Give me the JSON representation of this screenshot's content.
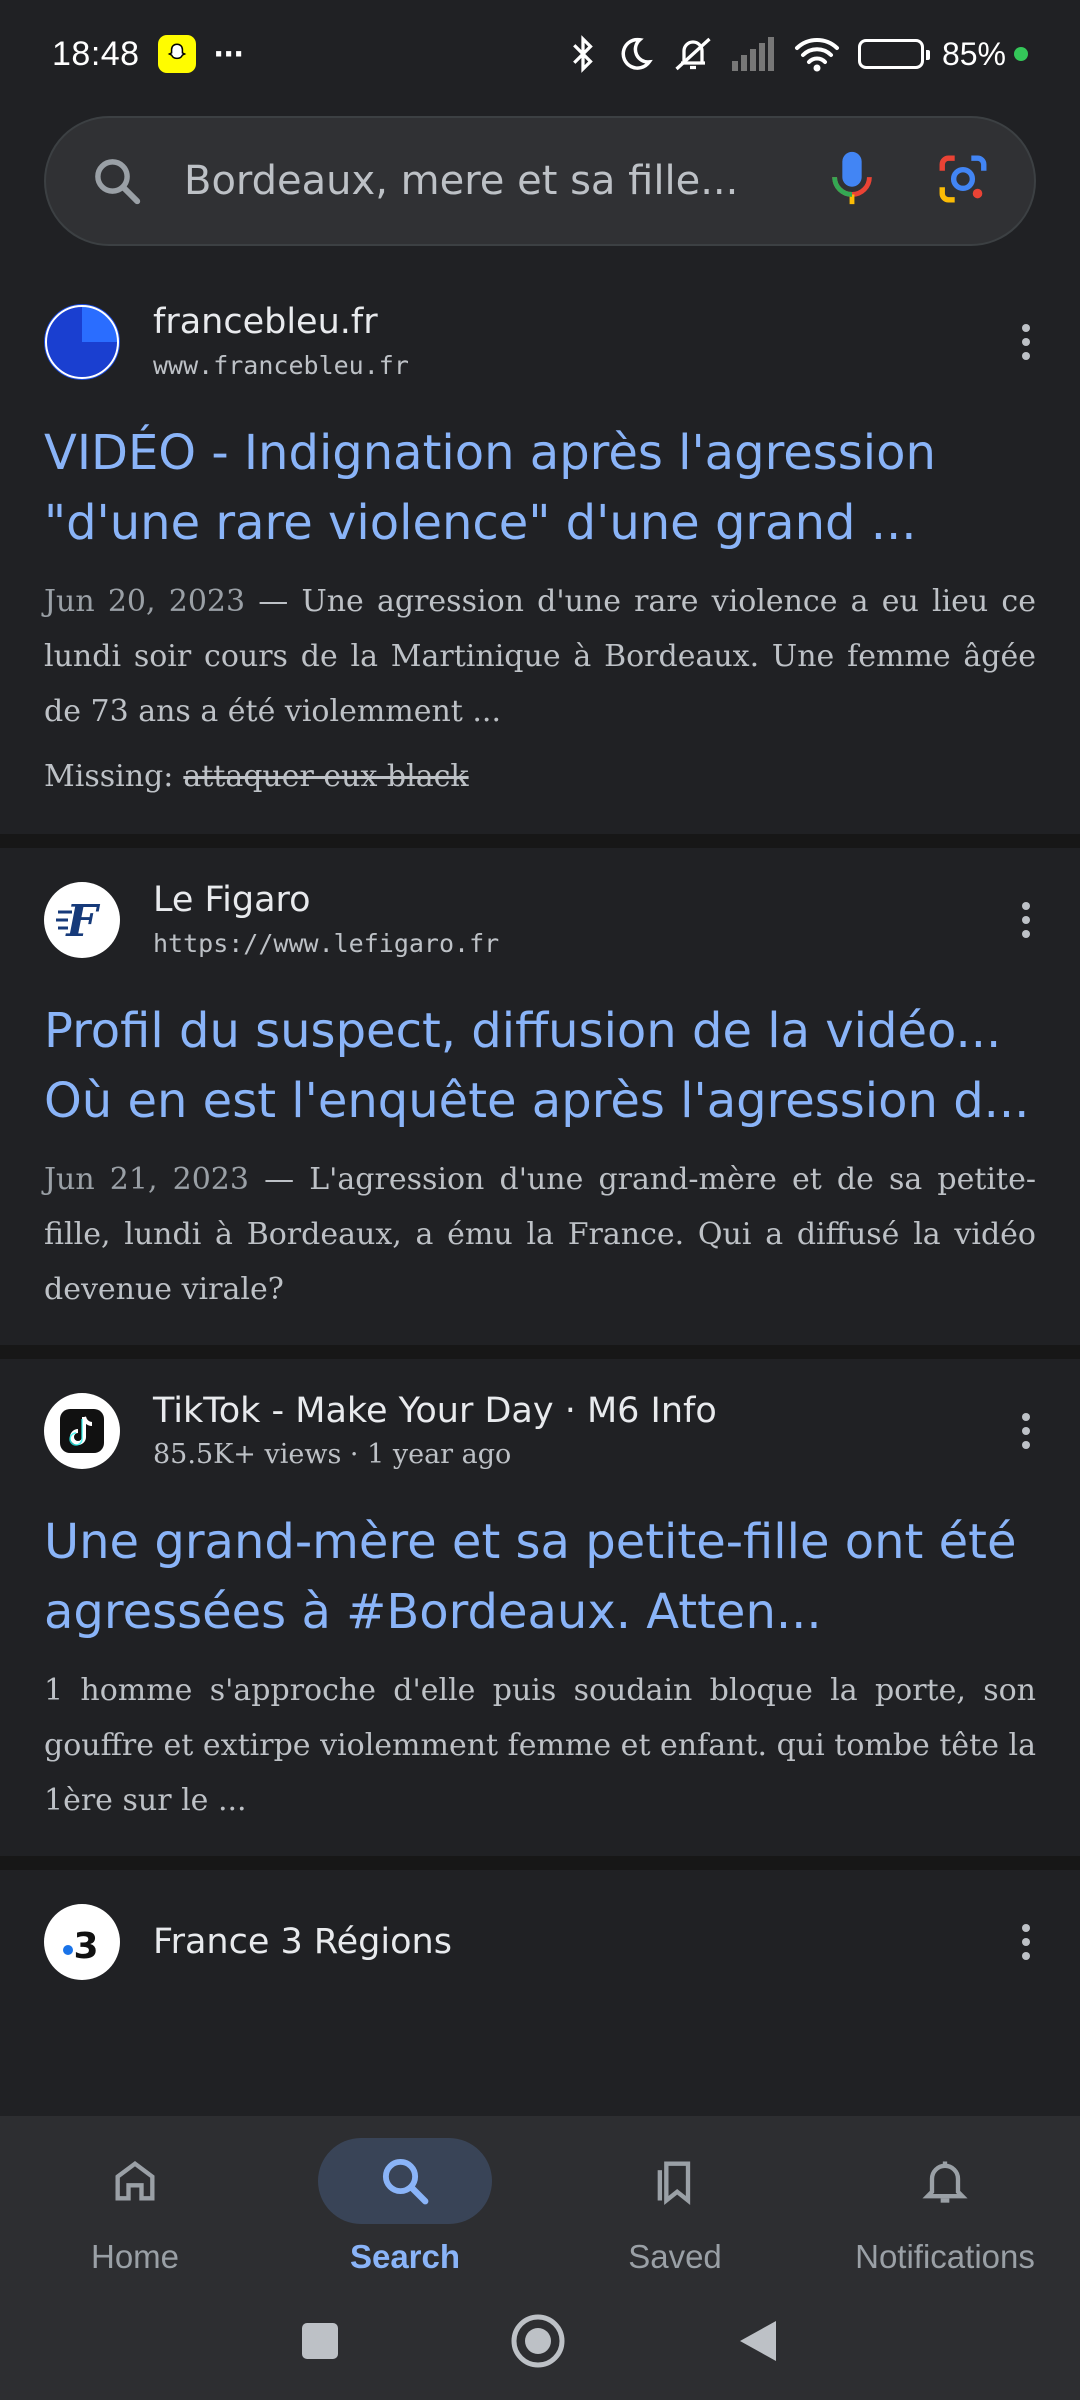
{
  "status": {
    "time": "18:48",
    "battery": "85%",
    "battery_level": 0.85
  },
  "search": {
    "query": "Bordeaux, mere et sa fille..."
  },
  "results": [
    {
      "source": "francebleu.fr",
      "url": "www.francebleu.fr",
      "title": "VIDÉO - Indignation après l'agression \"d'une rare violence\" d'une grand ...",
      "date": "Jun 20, 2023",
      "snippet": " — Une agression d'une rare violence a eu lieu ce lundi soir cours de la Martinique à Bordeaux. Une femme âgée de 73 ans a été violemment ...",
      "missing_label": "Missing:",
      "missing_terms": "attaquer eux black"
    },
    {
      "source": "Le Figaro",
      "url": "https://www.lefigaro.fr",
      "title": "Profil du suspect, diffusion de la vidéo... Où en est l'enquête après l'agression d...",
      "date": "Jun 21, 2023",
      "snippet": " — L'agression d'une grand-mère et de sa petite-fille, lundi à Bordeaux, a ému la France. Qui a diffusé la vidéo devenue virale?"
    },
    {
      "source": "TikTok - Make Your Day · M6 Info",
      "url": "85.5K+ views · 1 year ago",
      "title": "Une grand-mère et sa petite-fille ont été agressées à #Bordeaux. Atten...",
      "snippet": "1 homme s'approche d'elle puis soudain bloque la porte, son gouffre et extirpe violemment femme et enfant. qui tombe tête la 1ère sur le ..."
    },
    {
      "source": "France 3 Régions"
    }
  ],
  "nav": {
    "home": "Home",
    "search": "Search",
    "saved": "Saved",
    "notifications": "Notifications"
  },
  "colors": {
    "link": "#8ab4f8",
    "background": "#202124",
    "active_pill": "#394457"
  }
}
